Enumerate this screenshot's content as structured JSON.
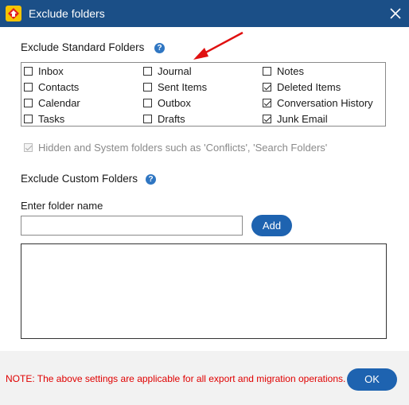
{
  "window": {
    "title": "Exclude folders"
  },
  "standard": {
    "title": "Exclude Standard Folders",
    "folders": [
      {
        "label": "Inbox",
        "checked": false
      },
      {
        "label": "Journal",
        "checked": false
      },
      {
        "label": "Notes",
        "checked": false
      },
      {
        "label": "Contacts",
        "checked": false
      },
      {
        "label": "Sent Items",
        "checked": false
      },
      {
        "label": "Deleted Items",
        "checked": true
      },
      {
        "label": "Calendar",
        "checked": false
      },
      {
        "label": "Outbox",
        "checked": false
      },
      {
        "label": "Conversation History",
        "checked": true
      },
      {
        "label": "Tasks",
        "checked": false
      },
      {
        "label": "Drafts",
        "checked": false
      },
      {
        "label": "Junk Email",
        "checked": true
      }
    ],
    "hidden_option": {
      "label": "Hidden and System folders such as 'Conflicts', 'Search Folders'",
      "checked": true,
      "disabled": true
    }
  },
  "custom": {
    "title": "Exclude Custom Folders",
    "input_label": "Enter folder name",
    "input_value": "",
    "add_label": "Add",
    "items": []
  },
  "footer": {
    "note": "NOTE: The above settings are applicable for all export and migration operations.",
    "ok_label": "OK"
  },
  "colors": {
    "titlebar": "#1b4f87",
    "accent": "#1e63b0",
    "note": "#e00000",
    "annotation_arrow": "#e01010"
  }
}
